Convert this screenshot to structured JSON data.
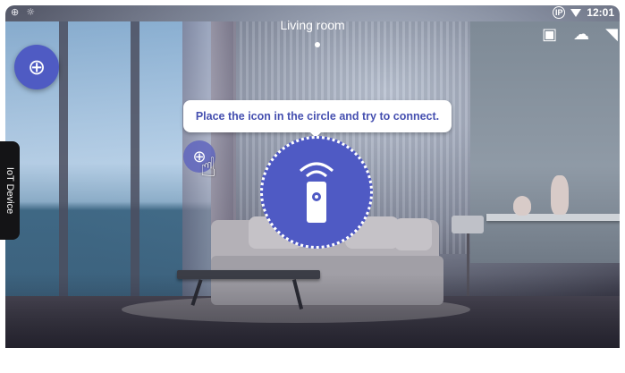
{
  "status_bar": {
    "left_icons": [
      "add-circle-icon",
      "notification-icon"
    ],
    "ip_badge": "IP",
    "time": "12:01"
  },
  "header": {
    "room_title": "Living room",
    "page_indicator_active": 1
  },
  "top_right_icons": [
    "camera-warning-icon",
    "cloud-disconnected-icon",
    "wifi-off-icon"
  ],
  "add_button": {
    "icon": "add-circle-icon"
  },
  "side_tab": {
    "label": "IoT Device",
    "icon": "add-circle-icon"
  },
  "tooltip": {
    "text": "Place the icon in the circle and try to connect."
  },
  "target_circle": {
    "icon": "remote-wifi-icon"
  },
  "drag_icon": {
    "icon": "add-circle-icon"
  },
  "hand_pointer": {
    "icon": "hand-pointer-icon"
  },
  "colors": {
    "accent": "#4f5ac4",
    "tooltip_text": "#4650b0"
  }
}
